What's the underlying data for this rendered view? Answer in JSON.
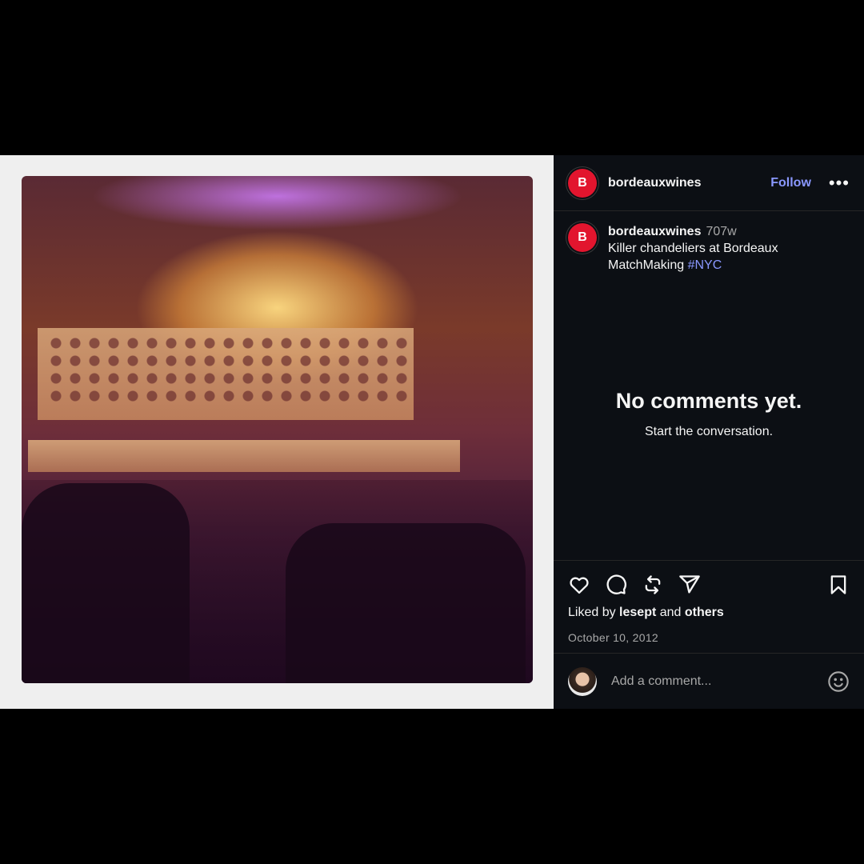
{
  "post": {
    "author": {
      "username": "bordeauxwines",
      "avatar_letter": "B"
    },
    "follow_label": "Follow",
    "more_label": "•••",
    "caption": {
      "username": "bordeauxwines",
      "time": "707w",
      "text": "Killer chandeliers at Bordeaux MatchMaking ",
      "hashtag": "#NYC"
    },
    "empty_state": {
      "title": "No comments yet.",
      "subtitle": "Start the conversation."
    },
    "actions": {
      "like": "heart-icon",
      "comment": "comment-icon",
      "repost": "repost-icon",
      "share": "share-icon",
      "save": "bookmark-icon"
    },
    "likes": {
      "prefix": "Liked by ",
      "user": "lesept",
      "middle": " and ",
      "others": "others"
    },
    "date": "October 10, 2012",
    "comment_box": {
      "placeholder": "Add a comment..."
    }
  },
  "colors": {
    "accent": "#8a98ff",
    "brand_red": "#e2152e",
    "panel_bg": "#0c0f14"
  }
}
